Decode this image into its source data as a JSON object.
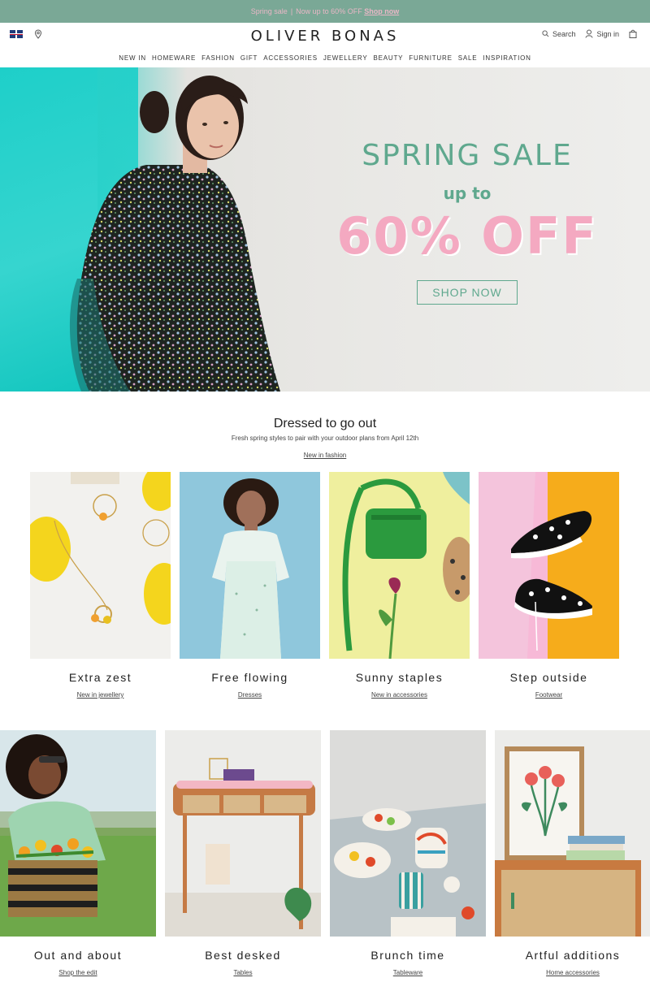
{
  "promo": {
    "text": "Spring sale",
    "sep": "|",
    "offer": "Now up to 60% OFF",
    "link": "Shop now"
  },
  "header": {
    "logo": "OLIVER BONAS",
    "search_label": "Search",
    "signin_label": "Sign in"
  },
  "nav": [
    "NEW IN",
    "HOMEWARE",
    "FASHION",
    "GIFT",
    "ACCESSORIES",
    "JEWELLERY",
    "BEAUTY",
    "FURNITURE",
    "SALE",
    "INSPIRATION"
  ],
  "hero": {
    "title": "SPRING SALE",
    "upto": "up to",
    "discount": "60% OFF",
    "cta": "SHOP NOW"
  },
  "section": {
    "title": "Dressed to go out",
    "subtitle": "Fresh spring styles to pair with your outdoor plans from April 12th",
    "link": "New in fashion"
  },
  "row1": [
    {
      "title": "Extra zest",
      "link": "New in jewellery"
    },
    {
      "title": "Free flowing",
      "link": "Dresses"
    },
    {
      "title": "Sunny staples",
      "link": "New in accessories"
    },
    {
      "title": "Step outside",
      "link": "Footwear"
    }
  ],
  "row2": [
    {
      "title": "Out and about",
      "link": "Shop the edit"
    },
    {
      "title": "Best desked",
      "link": "Tables"
    },
    {
      "title": "Brunch time",
      "link": "Tableware"
    },
    {
      "title": "Artful additions",
      "link": "Home accessories"
    }
  ],
  "colors": {
    "accent": "#5fa88e",
    "pink": "#f4a9c1",
    "topbar": "#7aa896"
  }
}
